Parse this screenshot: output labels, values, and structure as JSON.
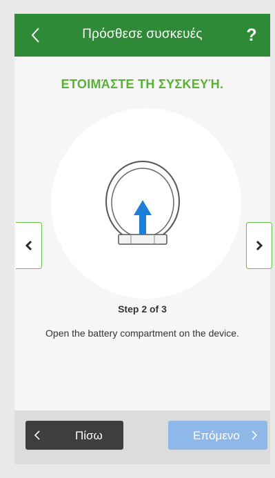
{
  "header": {
    "title": "Πρόσθεσε συσκευές",
    "help_label": "?"
  },
  "main": {
    "heading": "ΕΤΟΙΜΆΣΤΕ ΤΗ ΣΥΣΚΕΥΉ.",
    "step_text": "Step 2 of 3",
    "description": "Open the battery compartment on the device."
  },
  "footer": {
    "back_label": "Πίσω",
    "next_label": "Επόμενο"
  },
  "colors": {
    "header_bg": "#2f8a37",
    "accent_green": "#58b231",
    "arrow_blue": "#1e7fd9",
    "back_button": "#3e3e3e",
    "next_button_disabled": "#8db8e8"
  },
  "icons": {
    "header_back": "chevron-left-icon",
    "carousel_prev": "chevron-left-icon",
    "carousel_next": "chevron-right-icon",
    "device": "device-battery-open-illustration",
    "arrow": "arrow-up-icon"
  }
}
